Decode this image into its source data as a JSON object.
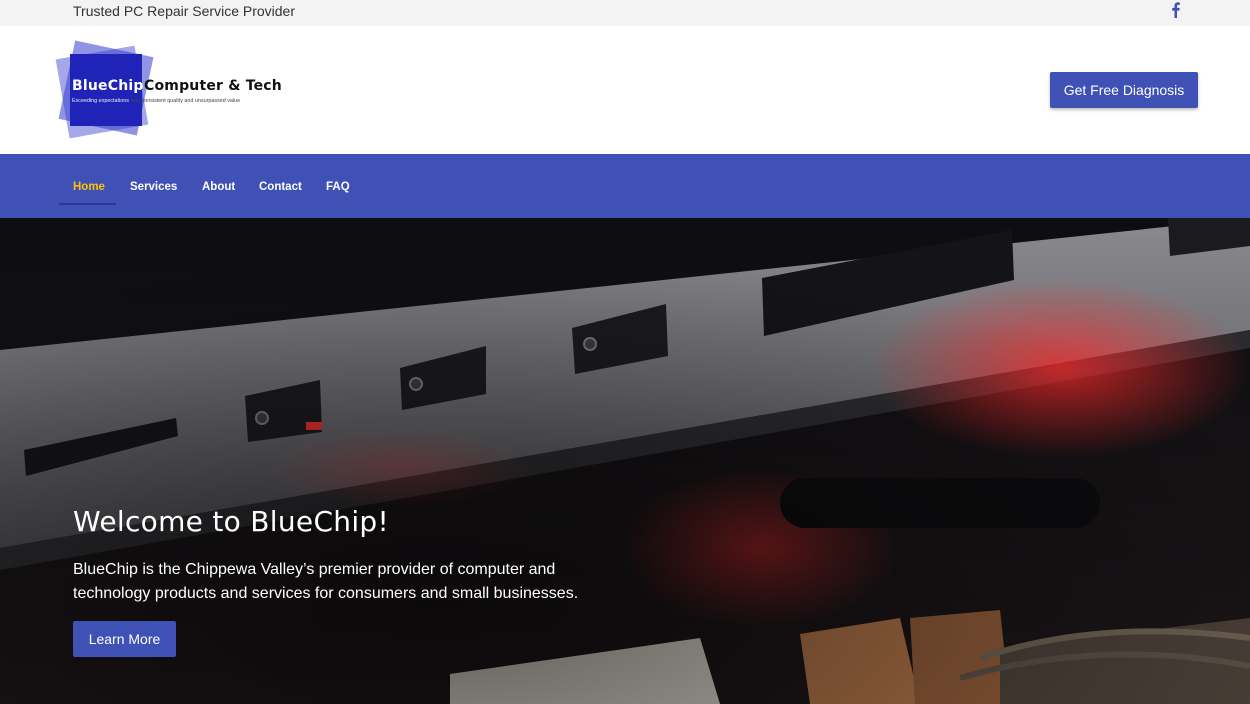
{
  "topbar": {
    "tagline": "Trusted PC Repair Service Provider",
    "social_icon": "facebook-icon"
  },
  "logo": {
    "brand_part1": "BlueChip",
    "brand_part2": "Computer & Tech",
    "slogan_part1": "Exceeding expectations",
    "slogan_part2": " with consistent quality and unsurpassed value"
  },
  "header": {
    "cta_label": "Get Free Diagnosis"
  },
  "nav": {
    "items": [
      "Home",
      "Services",
      "About",
      "Contact",
      "FAQ"
    ],
    "active": "Home"
  },
  "hero": {
    "title": "Welcome to BlueChip!",
    "text": "BlueChip is the Chippewa Valley’s premier provider of computer and technology products and services for consumers and small businesses.",
    "button_label": "Learn More"
  },
  "colors": {
    "brand_blue": "#3f51b5",
    "active_nav": "#ffc107",
    "topbar_bg": "#f3f3f3",
    "logo_blue": "#1f23b8"
  }
}
